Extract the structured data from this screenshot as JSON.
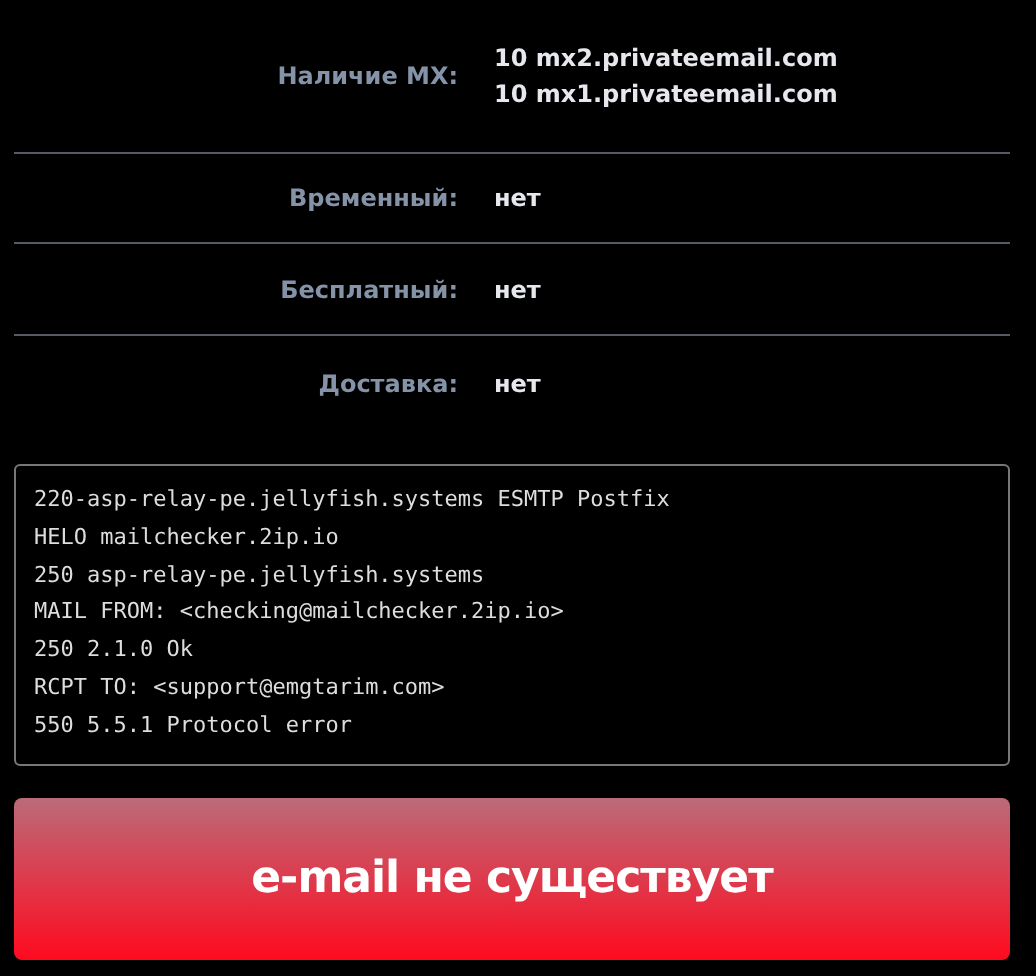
{
  "details": [
    {
      "label": "Наличие MX:",
      "values": [
        "10 mx2.privateemail.com",
        "10 mx1.privateemail.com"
      ]
    },
    {
      "label": "Временный:",
      "values": [
        "нет"
      ]
    },
    {
      "label": "Бесплатный:",
      "values": [
        "нет"
      ]
    },
    {
      "label": "Доставка:",
      "values": [
        "нет"
      ]
    }
  ],
  "smtp_log": [
    "220-asp-relay-pe.jellyfish.systems ESMTP Postfix",
    "HELO mailchecker.2ip.io",
    "250 asp-relay-pe.jellyfish.systems",
    "MAIL FROM: <checking@mailchecker.2ip.io>",
    "250 2.1.0 Ok",
    "RCPT TO: <support@emgtarim.com>",
    "550 5.5.1 Protocol error"
  ],
  "result": {
    "text": "e-mail не существует",
    "kind": "error"
  }
}
